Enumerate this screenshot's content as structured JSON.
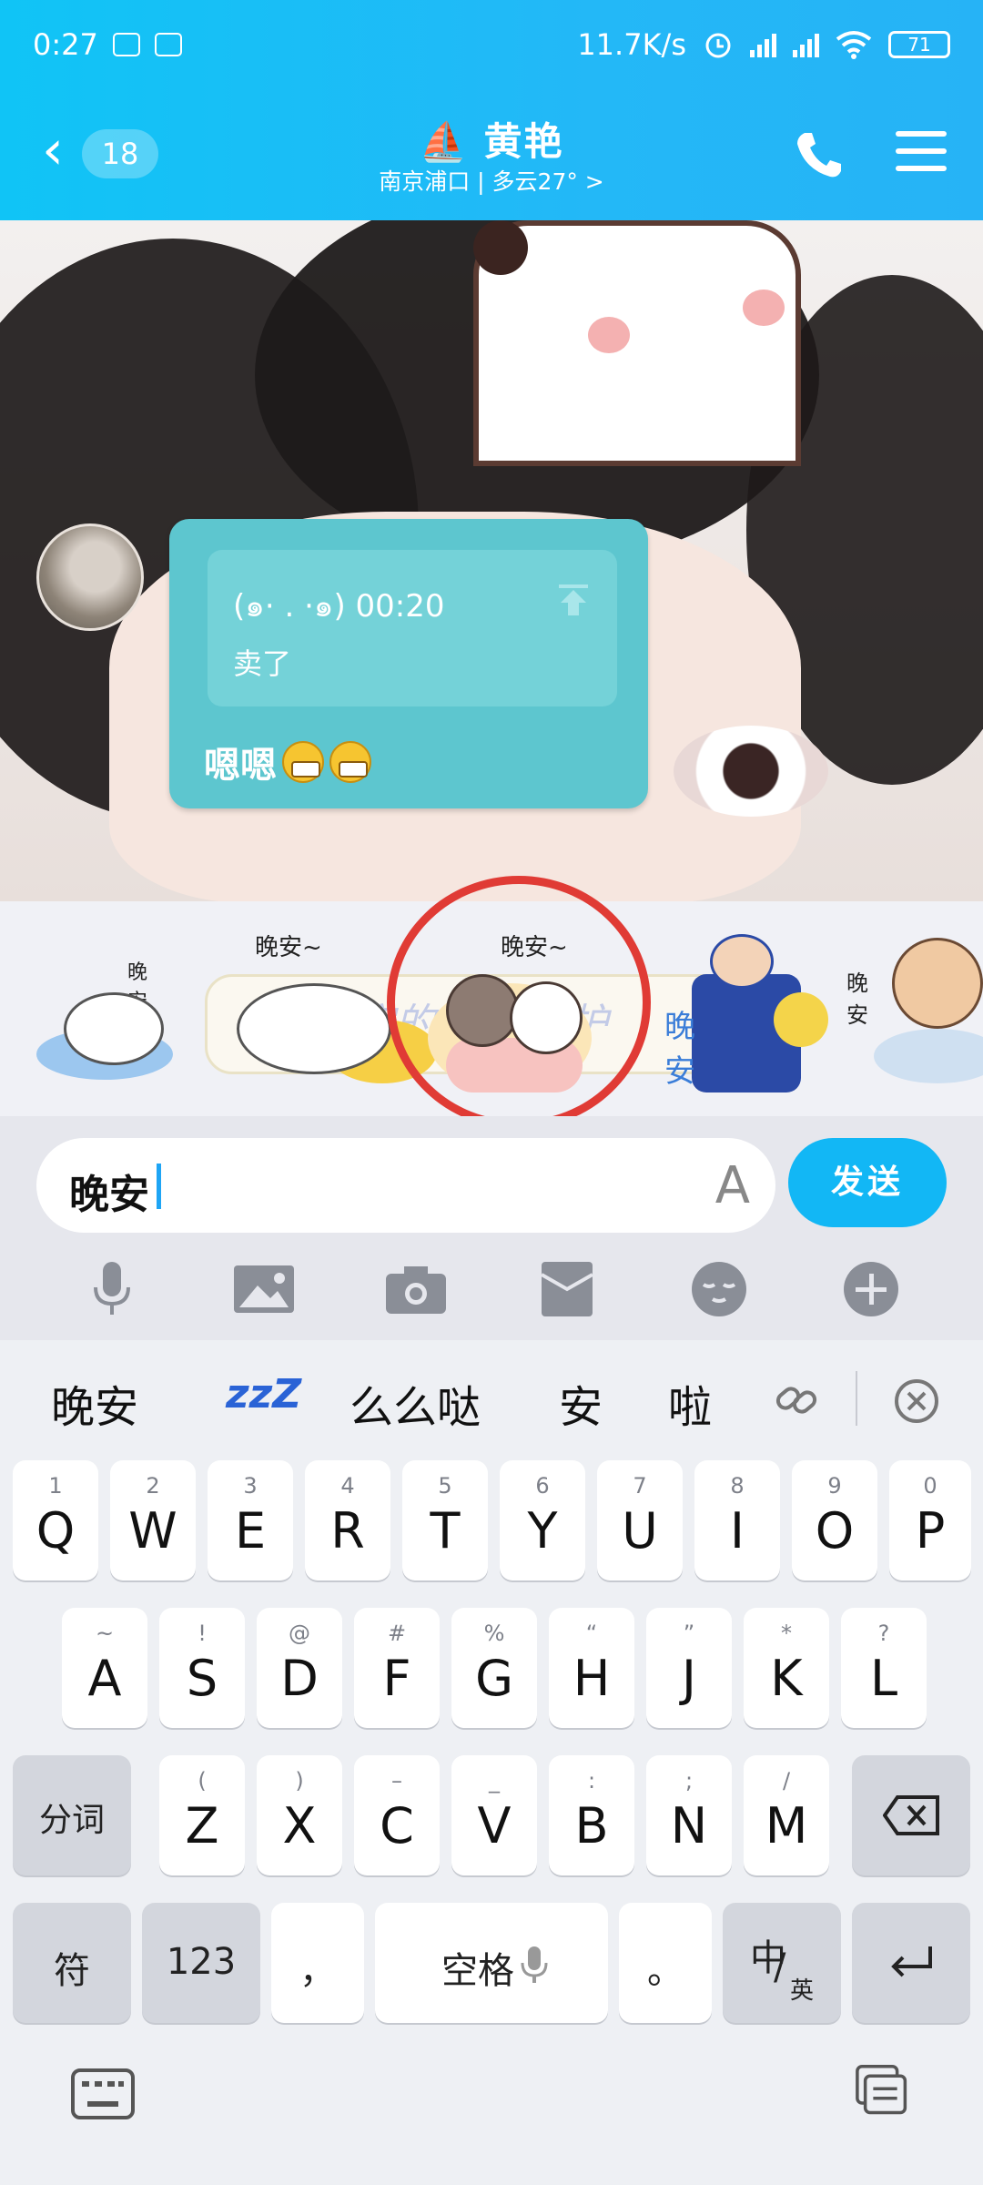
{
  "status_bar": {
    "time": "0:27",
    "network_speed": "11.7K/s",
    "battery": "71"
  },
  "chat_header": {
    "unread_count": "18",
    "title": "⛵ 黄艳",
    "subtitle": "南京浦口 | 多云27° >"
  },
  "message": {
    "quote_sender_time": "(๑· . ·๑) 00:20",
    "quote_text": "卖了",
    "text": "嗯嗯"
  },
  "sticker_strip": {
    "stickers": [
      {
        "label": "晚安"
      },
      {
        "label": "晚安~"
      },
      {
        "label": "晚安~"
      },
      {
        "label": "晚安"
      },
      {
        "label": "晚安"
      }
    ],
    "caption_text": "有一晚安的 —直守护"
  },
  "input": {
    "value": "晚安",
    "send_label": "发送"
  },
  "keyboard": {
    "candidates": [
      "晚安",
      "zzZ",
      "么么哒",
      "安",
      "啦"
    ],
    "row1": [
      {
        "sub": "1",
        "key": "Q"
      },
      {
        "sub": "2",
        "key": "W"
      },
      {
        "sub": "3",
        "key": "E"
      },
      {
        "sub": "4",
        "key": "R"
      },
      {
        "sub": "5",
        "key": "T"
      },
      {
        "sub": "6",
        "key": "Y"
      },
      {
        "sub": "7",
        "key": "U"
      },
      {
        "sub": "8",
        "key": "I"
      },
      {
        "sub": "9",
        "key": "O"
      },
      {
        "sub": "0",
        "key": "P"
      }
    ],
    "row2": [
      {
        "sub": "~",
        "key": "A"
      },
      {
        "sub": "!",
        "key": "S"
      },
      {
        "sub": "@",
        "key": "D"
      },
      {
        "sub": "#",
        "key": "F"
      },
      {
        "sub": "%",
        "key": "G"
      },
      {
        "sub": "“",
        "key": "H"
      },
      {
        "sub": "”",
        "key": "J"
      },
      {
        "sub": "*",
        "key": "K"
      },
      {
        "sub": "?",
        "key": "L"
      }
    ],
    "row3": [
      {
        "sub": "(",
        "key": "Z"
      },
      {
        "sub": ")",
        "key": "X"
      },
      {
        "sub": "–",
        "key": "C"
      },
      {
        "sub": "_",
        "key": "V"
      },
      {
        "sub": ":",
        "key": "B"
      },
      {
        "sub": ";",
        "key": "N"
      },
      {
        "sub": "/",
        "key": "M"
      }
    ],
    "split_label": "分词",
    "symbol_label": "符",
    "num_label": "123",
    "comma": "，",
    "space_label": "空格",
    "period": "。",
    "lang_main": "中",
    "lang_sub": "英"
  }
}
